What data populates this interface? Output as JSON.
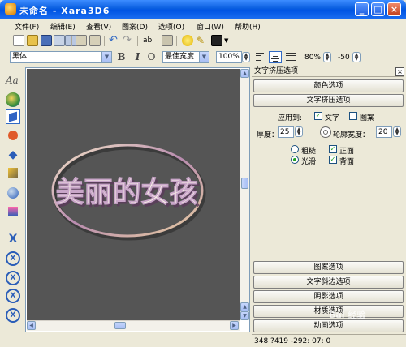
{
  "window": {
    "title": "未命名 - Xara3D6"
  },
  "menu": [
    {
      "label": "文件(F)"
    },
    {
      "label": "编辑(E)"
    },
    {
      "label": "查看(V)"
    },
    {
      "label": "图案(D)"
    },
    {
      "label": "选项(O)"
    },
    {
      "label": "窗口(W)"
    },
    {
      "label": "帮助(H)"
    }
  ],
  "fontbar": {
    "font_family": "黑体",
    "bold_label": "B",
    "italic_label": "I",
    "outline_label": "O",
    "width_mode": "最佳宽度",
    "zoom": "100%",
    "line_spacing": "80%",
    "char_spacing": "-50"
  },
  "canvas": {
    "text": "美丽的女孩",
    "bg_color": "#555555"
  },
  "panel": {
    "title": "文字挤压选项",
    "close_label": "×",
    "color_options": "颜色选项",
    "extrude_options": "文字挤压选项",
    "apply_to_label": "应用到:",
    "apply_text_label": "文字",
    "apply_text_checked": true,
    "apply_pattern_label": "图案",
    "apply_pattern_checked": false,
    "depth_label": "厚度：",
    "depth_value": "25",
    "outline_width_label": "轮廓宽度：",
    "outline_width_value": "20",
    "rough_label": "粗糙",
    "smooth_label": "光滑",
    "smooth_selected": true,
    "front_label": "正面",
    "front_checked": true,
    "back_label": "背面",
    "back_checked": true,
    "pattern_options": "图案选项",
    "bevel_options": "文字斜边选项",
    "shadow_options": "阴影选项",
    "material_options": "材质选项",
    "animation_options": "动画选项"
  },
  "status": {
    "text": "348 ?419 -292: 07: 0"
  },
  "watermark": "Bai 经验"
}
